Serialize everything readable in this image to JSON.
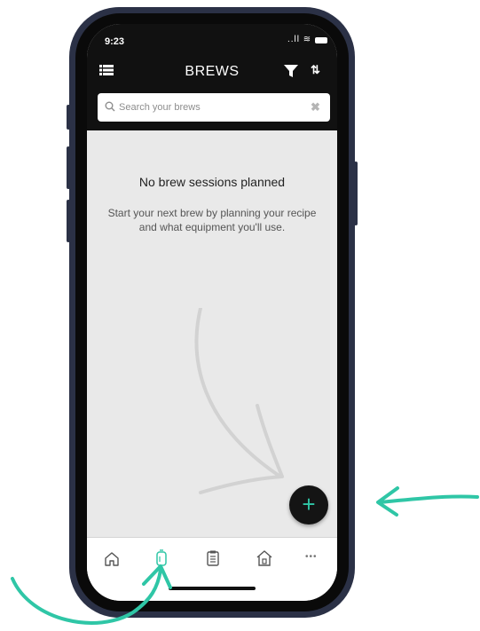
{
  "status_bar": {
    "time": "9:23",
    "signal_wifi": "..ll ≋"
  },
  "header": {
    "title": "BREWS",
    "sort_glyph": "⇅",
    "menu_icon": "list-icon",
    "filter_icon": "filter-icon"
  },
  "search": {
    "placeholder": "Search your brews",
    "value": "",
    "clear_glyph": "✖"
  },
  "empty_state": {
    "title": "No brew sessions planned",
    "subtitle": "Start your next brew by planning your recipe and what equipment you'll use."
  },
  "fab": {
    "label": "+",
    "color": "#2fc6a6"
  },
  "bottom_nav": {
    "items": [
      {
        "icon": "home-icon",
        "active": false
      },
      {
        "icon": "brew-fermenter-icon",
        "active": true
      },
      {
        "icon": "recipes-clipboard-icon",
        "active": false
      },
      {
        "icon": "brewery-house-icon",
        "active": false
      },
      {
        "icon": "more-icon",
        "active": false
      }
    ],
    "more_glyph": "•••",
    "active_color": "#2fc6a6"
  },
  "annotation_color": "#2fc6a6"
}
